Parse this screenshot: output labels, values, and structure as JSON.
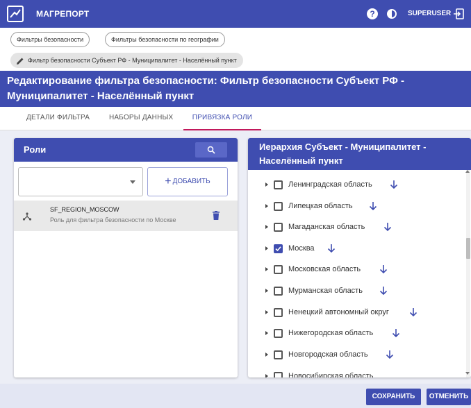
{
  "header": {
    "app_title": "МАГРЕПОРТ",
    "user": "SUPERUSER",
    "help_glyph": "?"
  },
  "breadcrumbs": [
    "Фильтры безопасности",
    "Фильтры безопасности по географии",
    "Фильтр безопасности Субъект РФ - Муниципалитет - Населённый пункт"
  ],
  "page_title": "Редактирование фильтра безопасности: Фильтр безопасности Субъект РФ - Муниципалитет - Населённый пункт",
  "tabs": [
    "ДЕТАЛИ ФИЛЬТРА",
    "НАБОРЫ ДАННЫХ",
    "ПРИВЯЗКА РОЛИ"
  ],
  "active_tab": 2,
  "roles_panel": {
    "title": "Роли",
    "select_value": "",
    "add_label": "ДОБАВИТЬ",
    "add_plus": "+",
    "roles": [
      {
        "name": "SF_REGION_MOSCOW",
        "description": "Роль для фильтра безопасности по Москве"
      }
    ]
  },
  "hierarchy_panel": {
    "title": "Иерархия Субъект - Муниципалитет - Населённый пункт",
    "items": [
      {
        "label": "Ленинградская область",
        "checked": false
      },
      {
        "label": "Липецкая область",
        "checked": false
      },
      {
        "label": "Магаданская область",
        "checked": false
      },
      {
        "label": "Москва",
        "checked": true
      },
      {
        "label": "Московская область",
        "checked": false
      },
      {
        "label": "Мурманская область",
        "checked": false
      },
      {
        "label": "Ненецкий автономный округ",
        "checked": false
      },
      {
        "label": "Нижегородская область",
        "checked": false
      },
      {
        "label": "Новгородская область",
        "checked": false
      },
      {
        "label": "Новосибирская область",
        "checked": false
      }
    ]
  },
  "footer": {
    "save_label": "СОХРАНИТЬ",
    "cancel_label": "ОТМЕНИТЬ"
  },
  "colors": {
    "primary": "#3f4db0",
    "accent": "#c2185b",
    "footer_bg": "#e3e6f3"
  }
}
